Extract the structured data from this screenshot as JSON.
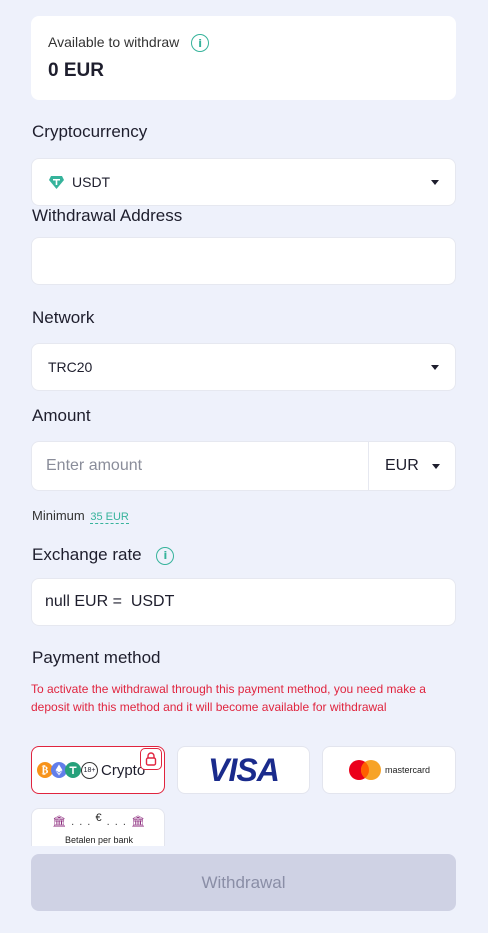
{
  "balance": {
    "label": "Available to withdraw",
    "value": "0 EUR"
  },
  "crypto": {
    "label": "Cryptocurrency",
    "selected": "USDT"
  },
  "address": {
    "label": "Withdrawal Address",
    "value": ""
  },
  "network": {
    "label": "Network",
    "selected": "TRC20"
  },
  "amount": {
    "label": "Amount",
    "placeholder": "Enter amount",
    "currency": "EUR"
  },
  "minimum": {
    "label": "Minimum",
    "value": "35 EUR"
  },
  "exchange": {
    "label": "Exchange rate",
    "value": "null EUR =  USDT"
  },
  "payment": {
    "label": "Payment method",
    "notice": "To activate the withdrawal through this payment method, you need make a deposit with this method and it will become available for withdrawal",
    "crypto_label": "Crypto",
    "crypto_badge": "18+",
    "visa_label": "VISA",
    "mastercard_label": "mastercard",
    "bank_label": "Betalen per bank",
    "bank_symbol": "€"
  },
  "submit": {
    "label": "Withdrawal"
  },
  "colors": {
    "accent": "#36b39b",
    "error": "#e0243e",
    "visa": "#1a2b8c",
    "button_disabled": "#cfd2e4"
  }
}
